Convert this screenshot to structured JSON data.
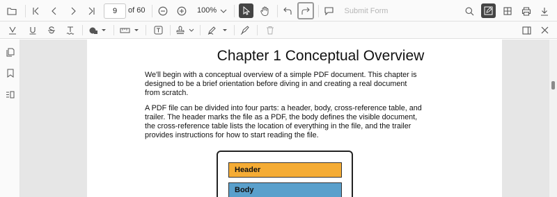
{
  "toolbar": {
    "current_page": "9",
    "page_count_label": "of 60",
    "zoom_label": "100%",
    "submit_form_label": "Submit Form"
  },
  "document": {
    "chapter_title": "Chapter 1  Conceptual Overview",
    "paragraphs": [
      "We'll begin with a conceptual overview of a simple PDF document. This chapter is designed to be a brief orientation before diving in and creating a real document from scratch.",
      "A PDF file can be divided into four parts: a header, body, cross-reference table, and trailer. The header marks the file as a PDF, the body defines the visible document, the cross-reference table lists the location of everything in the file, and the trailer provides instructions for how to start reading the file."
    ],
    "diagram": {
      "header_label": "Header",
      "body_label": "Body"
    }
  },
  "colors": {
    "diagram_header": "#f5ac35",
    "diagram_body": "#5aa0cc",
    "active_button": "#444444"
  },
  "icons": [
    "open-file-icon",
    "first-page-icon",
    "previous-page-icon",
    "next-page-icon",
    "last-page-icon",
    "zoom-out-icon",
    "zoom-in-icon",
    "chevron-down-icon",
    "select-cursor-icon",
    "pan-hand-icon",
    "undo-icon",
    "redo-icon",
    "comment-icon",
    "search-icon",
    "edit-annotation-icon",
    "organize-pages-icon",
    "print-icon",
    "download-icon",
    "highlight-icon",
    "underline-icon",
    "strikethrough-icon",
    "squiggly-icon",
    "shape-icon",
    "measure-icon",
    "free-text-icon",
    "stamp-icon",
    "signature-icon",
    "ink-icon",
    "delete-icon",
    "comment-panel-icon",
    "close-icon",
    "thumbnails-icon",
    "bookmark-icon",
    "organize-icon"
  ]
}
